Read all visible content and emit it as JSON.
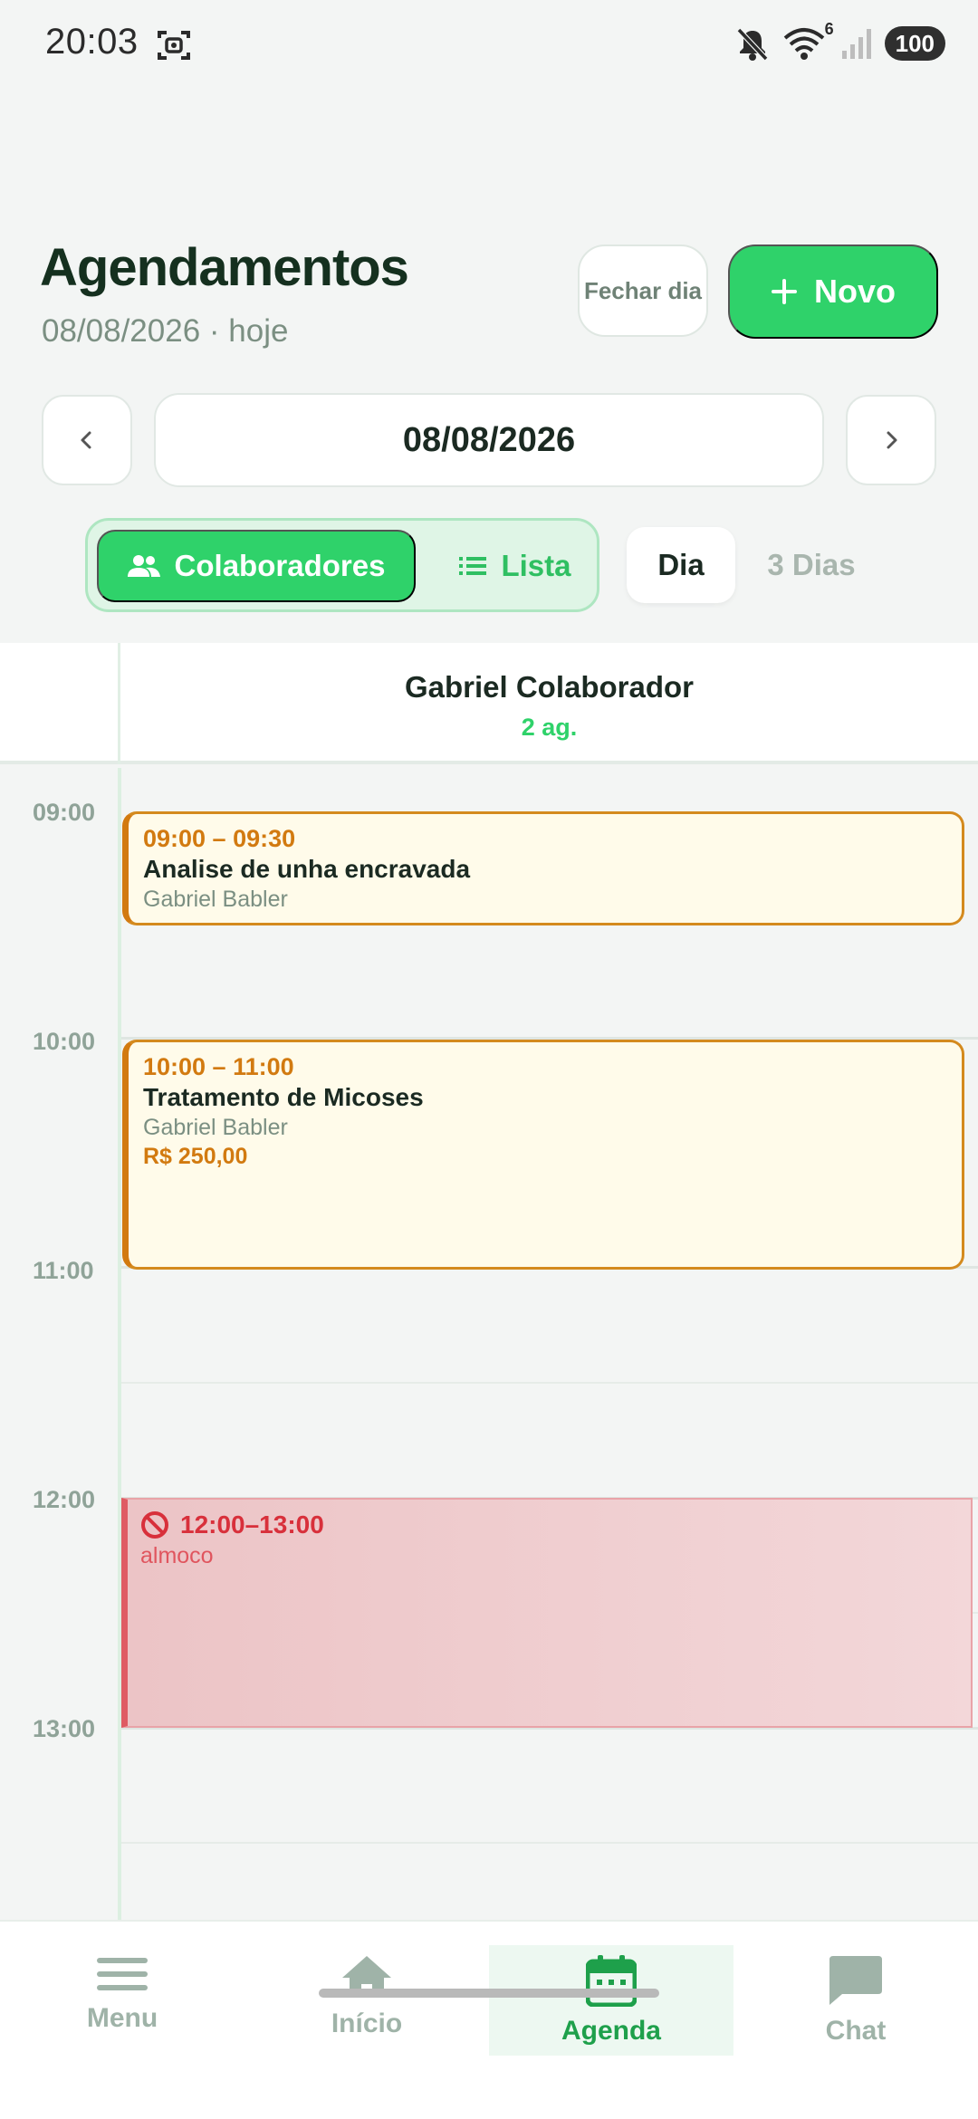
{
  "status_bar": {
    "time": "20:03",
    "wifi_badge": "6",
    "battery": "100"
  },
  "header": {
    "title": "Agendamentos",
    "subtitle": "08/08/2026 · hoje",
    "close_day_label": "Fechar dia",
    "new_label": "Novo"
  },
  "date_nav": {
    "date": "08/08/2026"
  },
  "view_toggle": {
    "collaborators": "Colaboradores",
    "list": "Lista"
  },
  "mode_toggle": {
    "day": "Dia",
    "three_days": "3 Dias"
  },
  "column": {
    "collaborator": "Gabriel Colaborador",
    "count": "2 ag."
  },
  "hours": [
    "09:00",
    "10:00",
    "11:00",
    "12:00",
    "13:00"
  ],
  "appointments": [
    {
      "time": "09:00 – 09:30",
      "title": "Analise de unha encravada",
      "client": "Gabriel Babler"
    },
    {
      "time": "10:00 – 11:00",
      "title": "Tratamento de Micoses",
      "client": "Gabriel Babler",
      "price": "R$ 250,00"
    }
  ],
  "blocked": {
    "time": "12:00–13:00",
    "label": "almoco"
  },
  "bottom_nav": {
    "menu": "Menu",
    "home": "Início",
    "agenda": "Agenda",
    "chat": "Chat"
  },
  "colors": {
    "accent": "#2fd26a",
    "appointment": "#d27a10",
    "blocked": "#df5b63"
  }
}
